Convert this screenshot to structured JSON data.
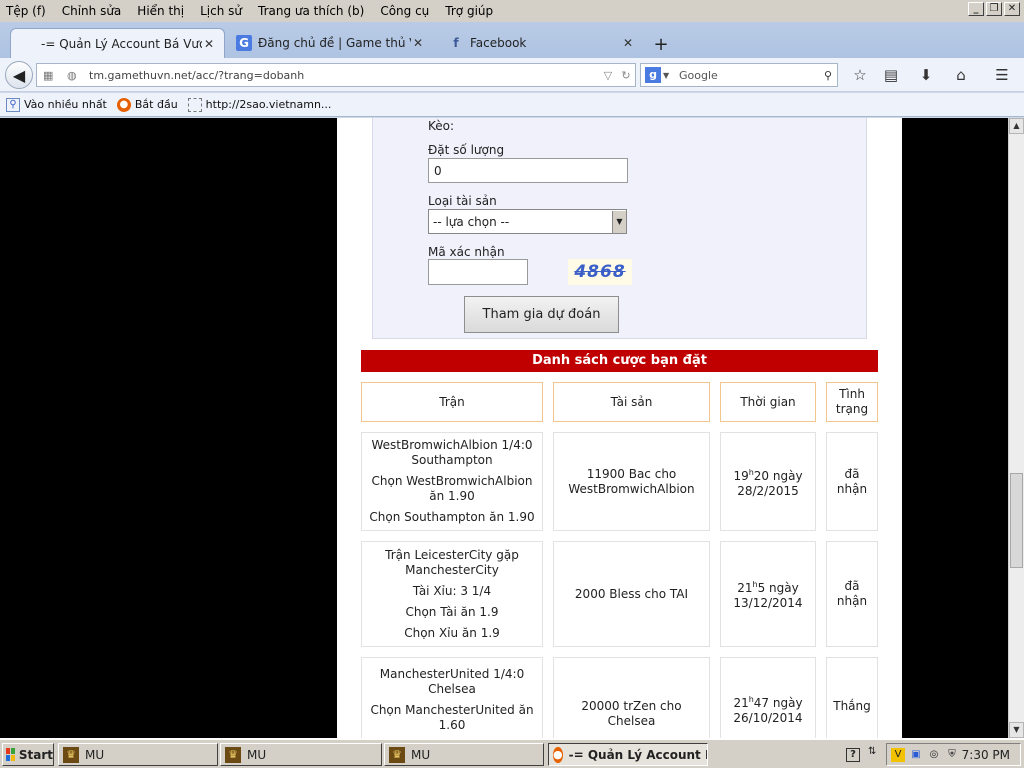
{
  "menu": [
    "Tệp (f)",
    "Chỉnh sửa",
    "Hiển thị",
    "Lịch sử",
    "Trang ưa thích (b)",
    "Công cụ",
    "Trợ giúp"
  ],
  "window_controls": {
    "minimize": "_",
    "restore": "❐",
    "close": "✕"
  },
  "tabs": [
    {
      "title": "-= Quản Lý Account Bá Vương =- ...",
      "icon": "page-icon",
      "active": true
    },
    {
      "title": "Đăng chủ đề | Game thủ Việt ...",
      "icon": "g-logo-icon",
      "active": false
    },
    {
      "title": "Facebook",
      "icon": "facebook-icon",
      "active": false
    }
  ],
  "urlbar": {
    "url": "tm.gamethuvn.net/acc/?trang=dobanh"
  },
  "search": {
    "placeholder": "Google"
  },
  "bookmarks": [
    {
      "label": "Vào nhiều nhất",
      "icon": "frequent-icon"
    },
    {
      "label": "Bắt đầu",
      "icon": "firefox-icon"
    },
    {
      "label": "http://2sao.vietnamn...",
      "icon": "blank-page-icon"
    }
  ],
  "form": {
    "keo_label": "Kèo:",
    "quantity_label": "Đặt số lượng",
    "quantity_value": "0",
    "asset_type_label": "Loại tài sản",
    "asset_type_value": "-- lựa chọn --",
    "captcha_label": "Mã xác nhận",
    "captcha_value": "",
    "captcha_text": "4868",
    "submit_label": "Tham gia dự đoán"
  },
  "bets": {
    "title": "Danh sách cược bạn đặt",
    "headers": [
      "Trận",
      "Tài sản",
      "Thời gian",
      "Tình trạng"
    ],
    "rows": [
      {
        "match": [
          "WestBromwichAlbion 1/4:0 Southampton",
          "Chọn WestBromwichAlbion ăn 1.90",
          "Chọn Southampton ăn 1.90"
        ],
        "asset": "11900 Bac cho WestBromwichAlbion",
        "time_hour": "19",
        "time_sup": "h",
        "time_min": "20 ngày",
        "time_date": "28/2/2015",
        "status": "đã nhận"
      },
      {
        "match": [
          "Trận LeicesterCity gặp ManchesterCity",
          "Tài Xỉu: 3 1/4",
          "Chọn Tài ăn 1.9",
          "Chọn Xỉu ăn 1.9"
        ],
        "asset": "2000 Bless cho TAI",
        "time_hour": "21",
        "time_sup": "h",
        "time_min": "5 ngày",
        "time_date": "13/12/2014",
        "status": "đã nhận"
      },
      {
        "match": [
          "ManchesterUnited 1/4:0 Chelsea",
          "Chọn ManchesterUnited ăn 1.60"
        ],
        "asset": "20000 trZen cho Chelsea",
        "time_hour": "21",
        "time_sup": "h",
        "time_min": "47 ngày",
        "time_date": "26/10/2014",
        "status": "Thắng"
      }
    ]
  },
  "taskbar": {
    "start_label": "Start",
    "buttons": [
      {
        "label": "MU",
        "icon": "mu-game-icon",
        "active": false
      },
      {
        "label": "MU",
        "icon": "mu-game-icon",
        "active": false
      },
      {
        "label": "MU",
        "icon": "mu-game-icon",
        "active": false
      },
      {
        "label": "-= Quản Lý Account B...",
        "icon": "firefox-icon",
        "active": true
      }
    ],
    "clock": "7:30 PM"
  },
  "colors": {
    "list_header": "#c00000",
    "form_bg": "#f0f1fb",
    "cell_header_border": "#f3c68e"
  }
}
